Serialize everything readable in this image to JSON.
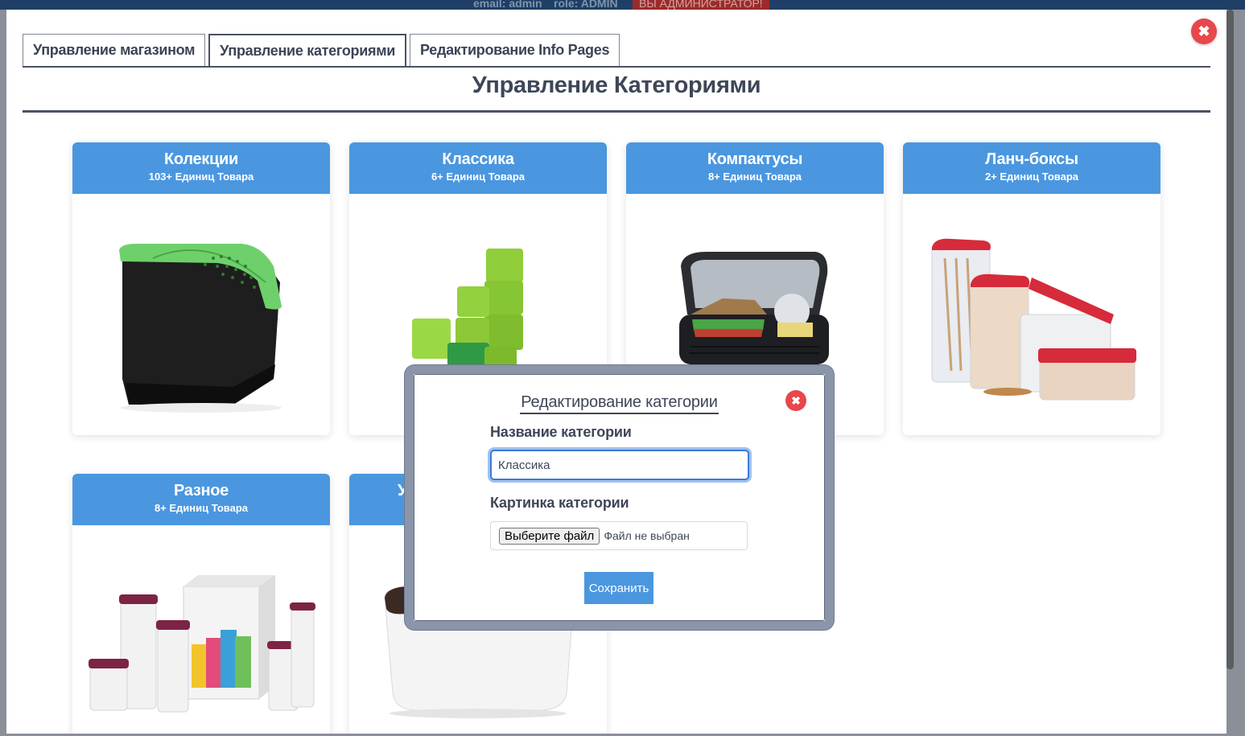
{
  "topbar": {
    "email_text": "email: admin",
    "role_text": "role: ADMIN",
    "admin_badge": "ВЫ АДМИНИСТРАТОР!"
  },
  "tabs": [
    {
      "label": "Управление магазином",
      "active": false
    },
    {
      "label": "Управление категориями",
      "active": true
    },
    {
      "label": "Редактирование Info Pages",
      "active": false
    }
  ],
  "page_title": "Управление Категориями",
  "categories": [
    {
      "name": "Колекции",
      "count": "103+ Единиц Товара",
      "image": "black-container-green-lid"
    },
    {
      "name": "Классика",
      "count": "6+ Единиц Товара",
      "image": "green-canisters"
    },
    {
      "name": "Компактусы",
      "count": "8+ Единиц Товара",
      "image": "lunchbox-sandwich"
    },
    {
      "name": "Ланч-боксы",
      "count": "2+ Единиц Товара",
      "image": "red-lid-containers"
    },
    {
      "name": "Разное",
      "count": "8+ Единиц Товара",
      "image": "tupperware-set"
    },
    {
      "name": "У",
      "count": "",
      "image": "white-container"
    }
  ],
  "dialog": {
    "title": "Редактирование категории",
    "name_label": "Название категории",
    "name_value": "Классика",
    "image_label": "Картинка категории",
    "file_button": "Выберите файл",
    "file_status": "Файл не выбран",
    "save_label": "Сохранить"
  },
  "icons": {
    "close": "close-icon"
  },
  "colors": {
    "accent": "#4a97e0",
    "danger": "#e8474b",
    "dark": "#3e4658"
  }
}
